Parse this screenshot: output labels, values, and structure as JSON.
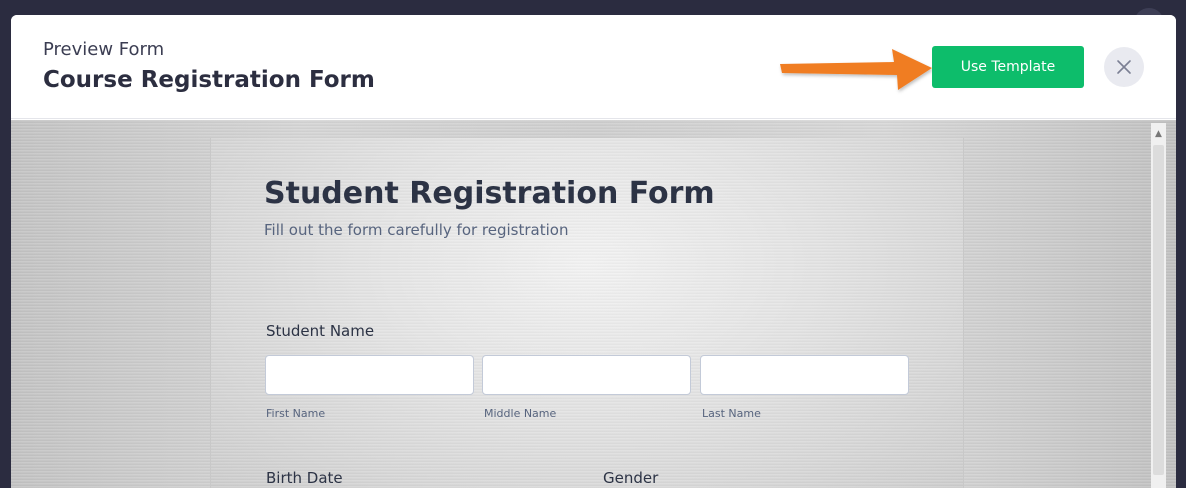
{
  "header": {
    "subtitle": "Preview Form",
    "title": "Course Registration Form",
    "use_template_label": "Use Template",
    "close_icon": "close-icon",
    "accent_color": "#0dbd6b",
    "arrow_color": "#f07d22"
  },
  "form": {
    "title": "Student Registration Form",
    "subtitle": "Fill out the form carefully for registration",
    "student_name": {
      "label": "Student Name",
      "first_label": "First Name",
      "middle_label": "Middle Name",
      "last_label": "Last Name",
      "first_value": "",
      "middle_value": "",
      "last_value": ""
    },
    "birth_date_label": "Birth Date",
    "gender_label": "Gender"
  }
}
